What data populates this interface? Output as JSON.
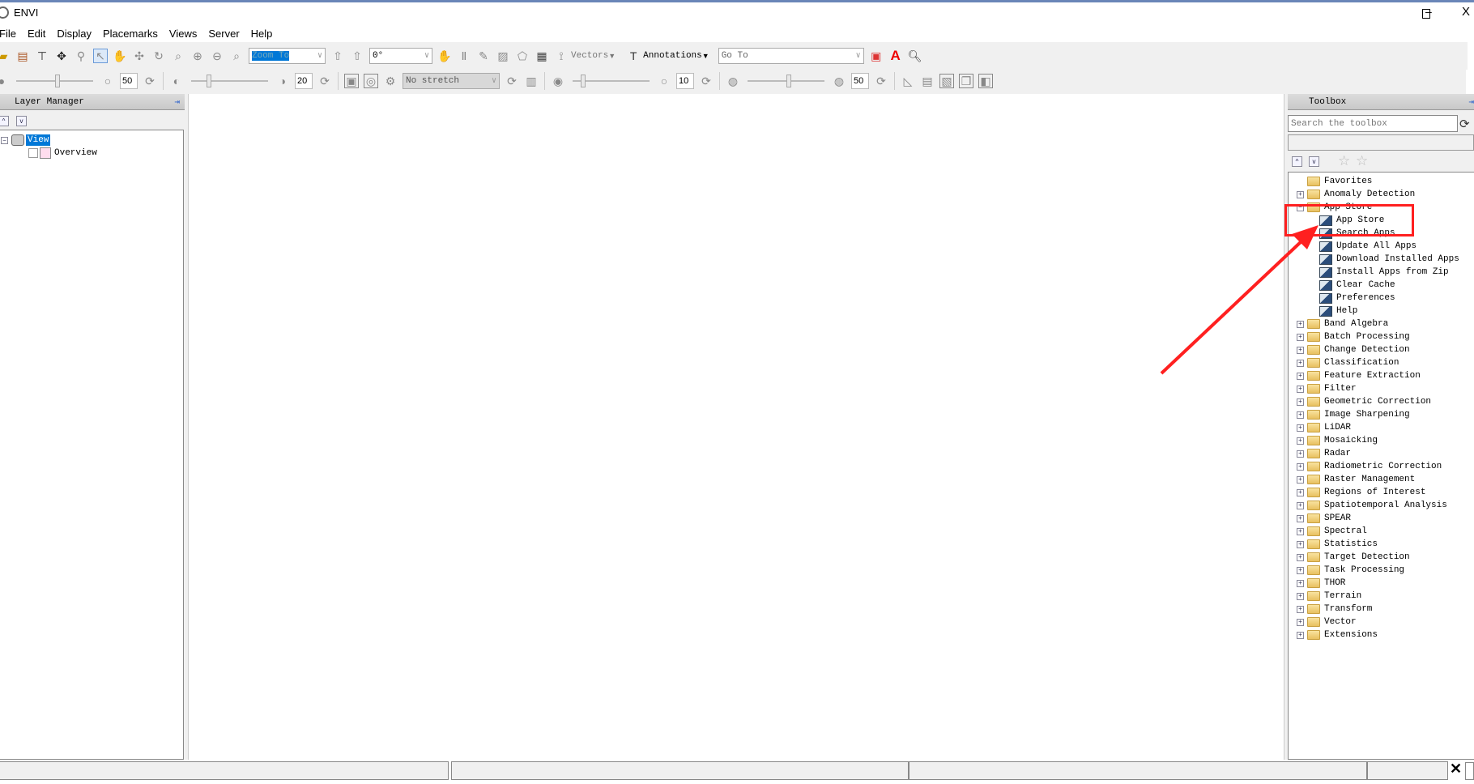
{
  "window": {
    "title": "ENVI",
    "minimize": "–",
    "maximize": "☐",
    "close": "X"
  },
  "menu": [
    "File",
    "Edit",
    "Display",
    "Placemarks",
    "Views",
    "Server",
    "Help"
  ],
  "toolbar": {
    "zoom_to": "Zoom To",
    "rotation": "0°",
    "vectors": "Vectors",
    "annotations": "Annotations",
    "goto_placeholder": "Go To"
  },
  "toolbar2": {
    "brightness": "50",
    "contrast": "20",
    "stretch": "No stretch",
    "sharpen": "10",
    "transparency": "50"
  },
  "layer_manager": {
    "title": "Layer Manager",
    "tree": [
      {
        "label": "View"
      },
      {
        "label": "Overview"
      }
    ]
  },
  "toolbox": {
    "title": "Toolbox",
    "search_placeholder": "Search the toolbox",
    "tree": [
      {
        "label": "Favorites",
        "level": 0,
        "type": "favorites"
      },
      {
        "label": "Anomaly Detection",
        "level": 0,
        "type": "folder",
        "expand": "+"
      },
      {
        "label": "App Store",
        "level": 0,
        "type": "folder",
        "expand": "−"
      },
      {
        "label": "App Store",
        "level": 1,
        "type": "tool"
      },
      {
        "label": "Search Apps",
        "level": 1,
        "type": "tool"
      },
      {
        "label": "Update All Apps",
        "level": 1,
        "type": "tool"
      },
      {
        "label": "Download Installed Apps",
        "level": 1,
        "type": "tool"
      },
      {
        "label": "Install Apps from Zip",
        "level": 1,
        "type": "tool"
      },
      {
        "label": "Clear Cache",
        "level": 1,
        "type": "tool"
      },
      {
        "label": "Preferences",
        "level": 1,
        "type": "tool"
      },
      {
        "label": "Help",
        "level": 1,
        "type": "tool"
      },
      {
        "label": "Band Algebra",
        "level": 0,
        "type": "folder",
        "expand": "+"
      },
      {
        "label": "Batch Processing",
        "level": 0,
        "type": "folder",
        "expand": "+"
      },
      {
        "label": "Change Detection",
        "level": 0,
        "type": "folder",
        "expand": "+"
      },
      {
        "label": "Classification",
        "level": 0,
        "type": "folder",
        "expand": "+"
      },
      {
        "label": "Feature Extraction",
        "level": 0,
        "type": "folder",
        "expand": "+"
      },
      {
        "label": "Filter",
        "level": 0,
        "type": "folder",
        "expand": "+"
      },
      {
        "label": "Geometric Correction",
        "level": 0,
        "type": "folder",
        "expand": "+"
      },
      {
        "label": "Image Sharpening",
        "level": 0,
        "type": "folder",
        "expand": "+"
      },
      {
        "label": "LiDAR",
        "level": 0,
        "type": "folder",
        "expand": "+"
      },
      {
        "label": "Mosaicking",
        "level": 0,
        "type": "folder",
        "expand": "+"
      },
      {
        "label": "Radar",
        "level": 0,
        "type": "folder",
        "expand": "+"
      },
      {
        "label": "Radiometric Correction",
        "level": 0,
        "type": "folder",
        "expand": "+"
      },
      {
        "label": "Raster Management",
        "level": 0,
        "type": "folder",
        "expand": "+"
      },
      {
        "label": "Regions of Interest",
        "level": 0,
        "type": "folder",
        "expand": "+"
      },
      {
        "label": "Spatiotemporal Analysis",
        "level": 0,
        "type": "folder",
        "expand": "+"
      },
      {
        "label": "SPEAR",
        "level": 0,
        "type": "folder",
        "expand": "+"
      },
      {
        "label": "Spectral",
        "level": 0,
        "type": "folder",
        "expand": "+"
      },
      {
        "label": "Statistics",
        "level": 0,
        "type": "folder",
        "expand": "+"
      },
      {
        "label": "Target Detection",
        "level": 0,
        "type": "folder",
        "expand": "+"
      },
      {
        "label": "Task Processing",
        "level": 0,
        "type": "folder",
        "expand": "+"
      },
      {
        "label": "THOR",
        "level": 0,
        "type": "folder",
        "expand": "+"
      },
      {
        "label": "Terrain",
        "level": 0,
        "type": "folder",
        "expand": "+"
      },
      {
        "label": "Transform",
        "level": 0,
        "type": "folder",
        "expand": "+"
      },
      {
        "label": "Vector",
        "level": 0,
        "type": "folder",
        "expand": "+"
      },
      {
        "label": "Extensions",
        "level": 0,
        "type": "folder",
        "expand": "+"
      }
    ]
  },
  "annotation": {
    "highlight_color": "#ff2020"
  }
}
